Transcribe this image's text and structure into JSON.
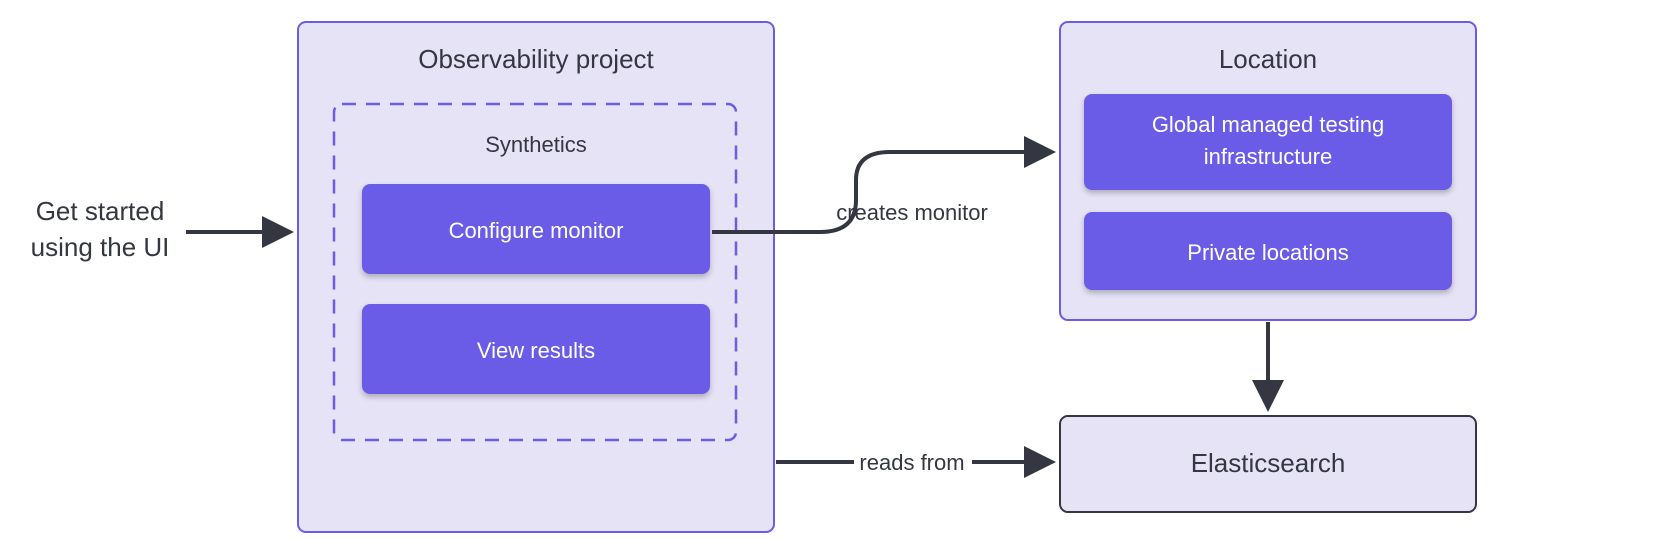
{
  "left_label_line1": "Get started",
  "left_label_line2": "using the UI",
  "observability": {
    "title": "Observability project",
    "synthetics_title": "Synthetics",
    "configure_btn": "Configure monitor",
    "view_btn": "View results"
  },
  "location": {
    "title": "Location",
    "global_line1": "Global managed testing",
    "global_line2": "infrastructure",
    "private": "Private locations"
  },
  "elasticsearch": "Elasticsearch",
  "edges": {
    "creates": "creates monitor",
    "reads": "reads from"
  },
  "colors": {
    "panel_bg": "#E6E3F7",
    "accent": "#6B5CE7",
    "text": "#343741",
    "btn_text": "#FFFFFF"
  }
}
